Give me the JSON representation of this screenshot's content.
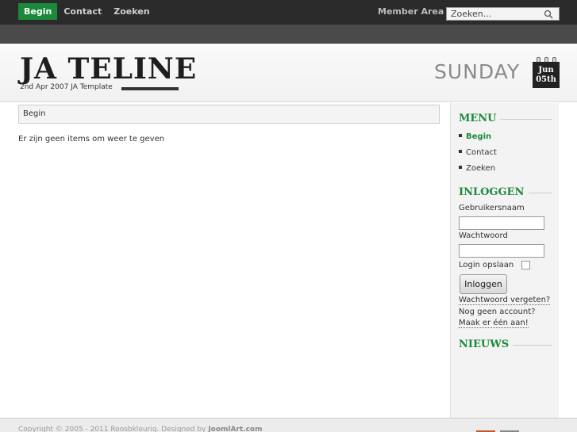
{
  "topnav": {
    "items": [
      {
        "label": "Begin",
        "active": true
      },
      {
        "label": "Contact",
        "active": false
      },
      {
        "label": "Zoeken",
        "active": false
      }
    ],
    "member_area": "Member Area",
    "search_placeholder": "Zoeken..."
  },
  "header": {
    "logo_title": "JA TELINE",
    "logo_tagline": "2nd Apr 2007 JA Template",
    "day_name": "SUNDAY",
    "month": "Jun",
    "day": "05th"
  },
  "main": {
    "breadcrumb": "Begin",
    "message": "Er zijn geen items om weer te geven"
  },
  "sidebar": {
    "menu_title": "MENU",
    "menu_items": [
      {
        "label": "Begin",
        "active": true
      },
      {
        "label": "Contact",
        "active": false
      },
      {
        "label": "Zoeken",
        "active": false
      }
    ],
    "login_title": "INLOGGEN",
    "username_label": "Gebruikersnaam",
    "password_label": "Wachtwoord",
    "remember_label": "Login opslaan",
    "login_button": "Inloggen",
    "forgot_password": "Wachtwoord vergeten?",
    "no_account": "Nog geen account?",
    "create_account": "Maak er één aan!",
    "news_title": "NIEUWS"
  },
  "footer": {
    "copyright": "Copyright © 2005 - 2011 Roosbkleurig. Designed by",
    "designer": "JoomlArt.com"
  },
  "colors": {
    "accent": "#1a8a3a",
    "topbar": "#2b2b2b"
  }
}
